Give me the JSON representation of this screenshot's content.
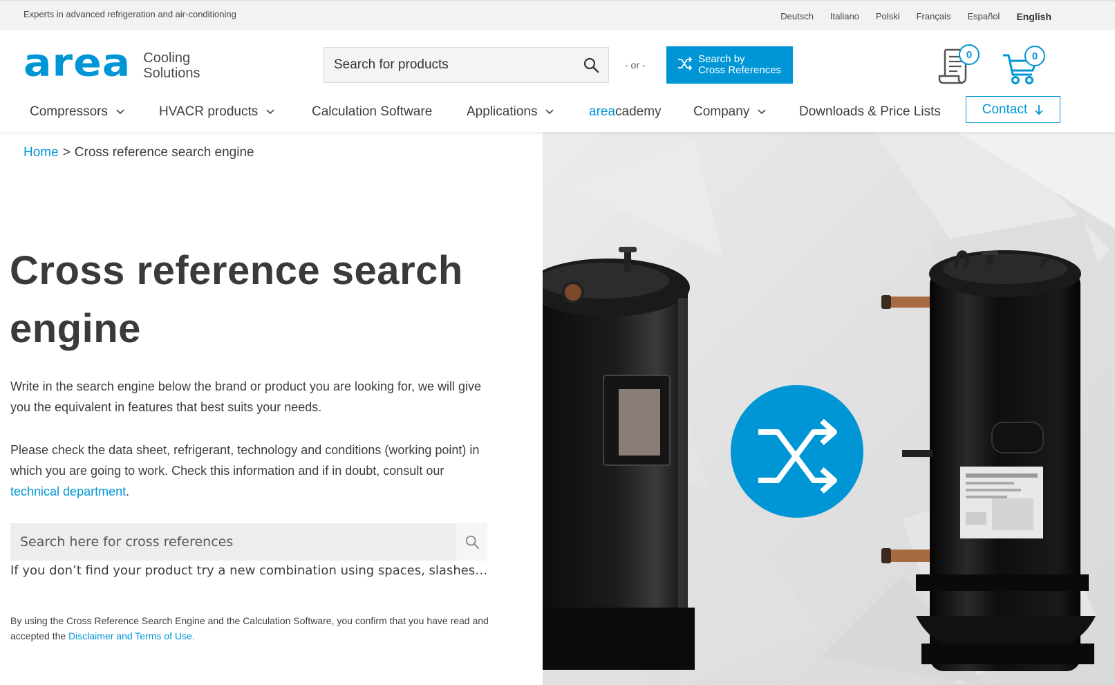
{
  "topbar": {
    "tagline": "Experts in advanced refrigeration and air-conditioning",
    "languages": [
      "Deutsch",
      "Italiano",
      "Polski",
      "Français",
      "Español",
      "English"
    ],
    "active_language": "English"
  },
  "header": {
    "logo_word": "area",
    "logo_sub_1": "Cooling",
    "logo_sub_2": "Solutions",
    "search_placeholder": "Search for products",
    "or_text": "- or -",
    "xref_button_line1": "Search by",
    "xref_button_line2": "Cross References",
    "quote_count": "0",
    "cart_count": "0"
  },
  "nav": {
    "items": [
      {
        "label": "Compressors",
        "dropdown": true
      },
      {
        "label": "HVACR products",
        "dropdown": true
      },
      {
        "label": "Calculation Software",
        "dropdown": false
      },
      {
        "label": "Applications",
        "dropdown": true
      },
      {
        "label_accent": "area",
        "label_rest": "cademy",
        "dropdown": false
      },
      {
        "label": "Company",
        "dropdown": true
      },
      {
        "label": "Downloads & Price Lists",
        "dropdown": false
      }
    ],
    "contact_label": "Contact"
  },
  "breadcrumb": {
    "home": "Home",
    "separator": ">",
    "current": "Cross reference search engine"
  },
  "main": {
    "title": "Cross reference search engine",
    "para1": "Write in the search engine below the brand or product you are looking for, we will give you the equivalent in features that best suits your needs.",
    "para2_text": "Please check the data sheet, refrigerant, technology and conditions (working point) in which you are going to work. Check this information and if in doubt, consult our",
    "para2_link": "technical department",
    "para2_end": ".",
    "xref_search_placeholder": "Search here for cross references",
    "hint": "If you don’t find your product try a new combination using spaces, slashes…",
    "disclaimer_text": "By using the Cross Reference Search Engine and the Calculation Software, you confirm that you have read and accepted the",
    "disclaimer_link": "Disclaimer and Terms of Use."
  },
  "colors": {
    "brand_blue": "#0096d6",
    "text": "#3a3a3a",
    "topbar_bg": "#f2f2f2"
  },
  "icons": [
    "search-icon",
    "shuffle-icon",
    "quote-list-icon",
    "cart-icon",
    "chevron-down-icon",
    "arrow-down-icon"
  ]
}
